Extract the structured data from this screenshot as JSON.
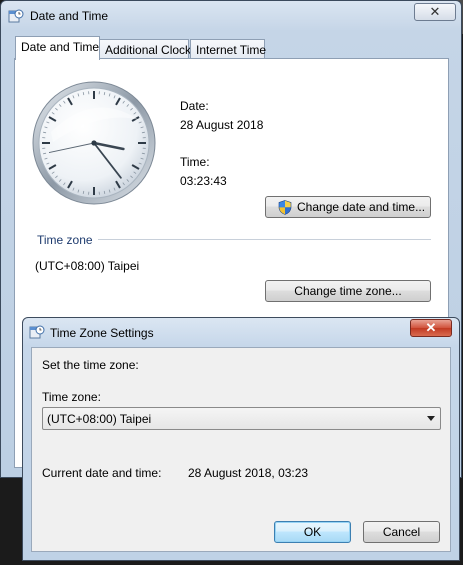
{
  "main_window": {
    "title": "Date and Time",
    "tabs": [
      {
        "label": "Date and Time"
      },
      {
        "label": "Additional Clocks"
      },
      {
        "label": "Internet Time"
      }
    ],
    "date_label": "Date:",
    "date_value": "28 August 2018",
    "time_label": "Time:",
    "time_value": "03:23:43",
    "change_datetime_button": "Change date and time...",
    "timezone_section_label": "Time zone",
    "timezone_value": "(UTC+08:00) Taipei",
    "change_timezone_button": "Change time zone...",
    "clock": {
      "hour": 3,
      "minute": 23,
      "second": 43
    }
  },
  "dialog": {
    "title": "Time Zone Settings",
    "instruction": "Set the time zone:",
    "timezone_label": "Time zone:",
    "timezone_selected": "(UTC+08:00) Taipei",
    "current_label": "Current date and time:",
    "current_value": "28 August 2018, 03:23",
    "ok_button": "OK",
    "cancel_button": "Cancel"
  },
  "icons": {
    "app": "date-time-icon",
    "shield": "uac-shield-icon",
    "dropdown": "chevron-down-icon",
    "close": "close-icon"
  }
}
